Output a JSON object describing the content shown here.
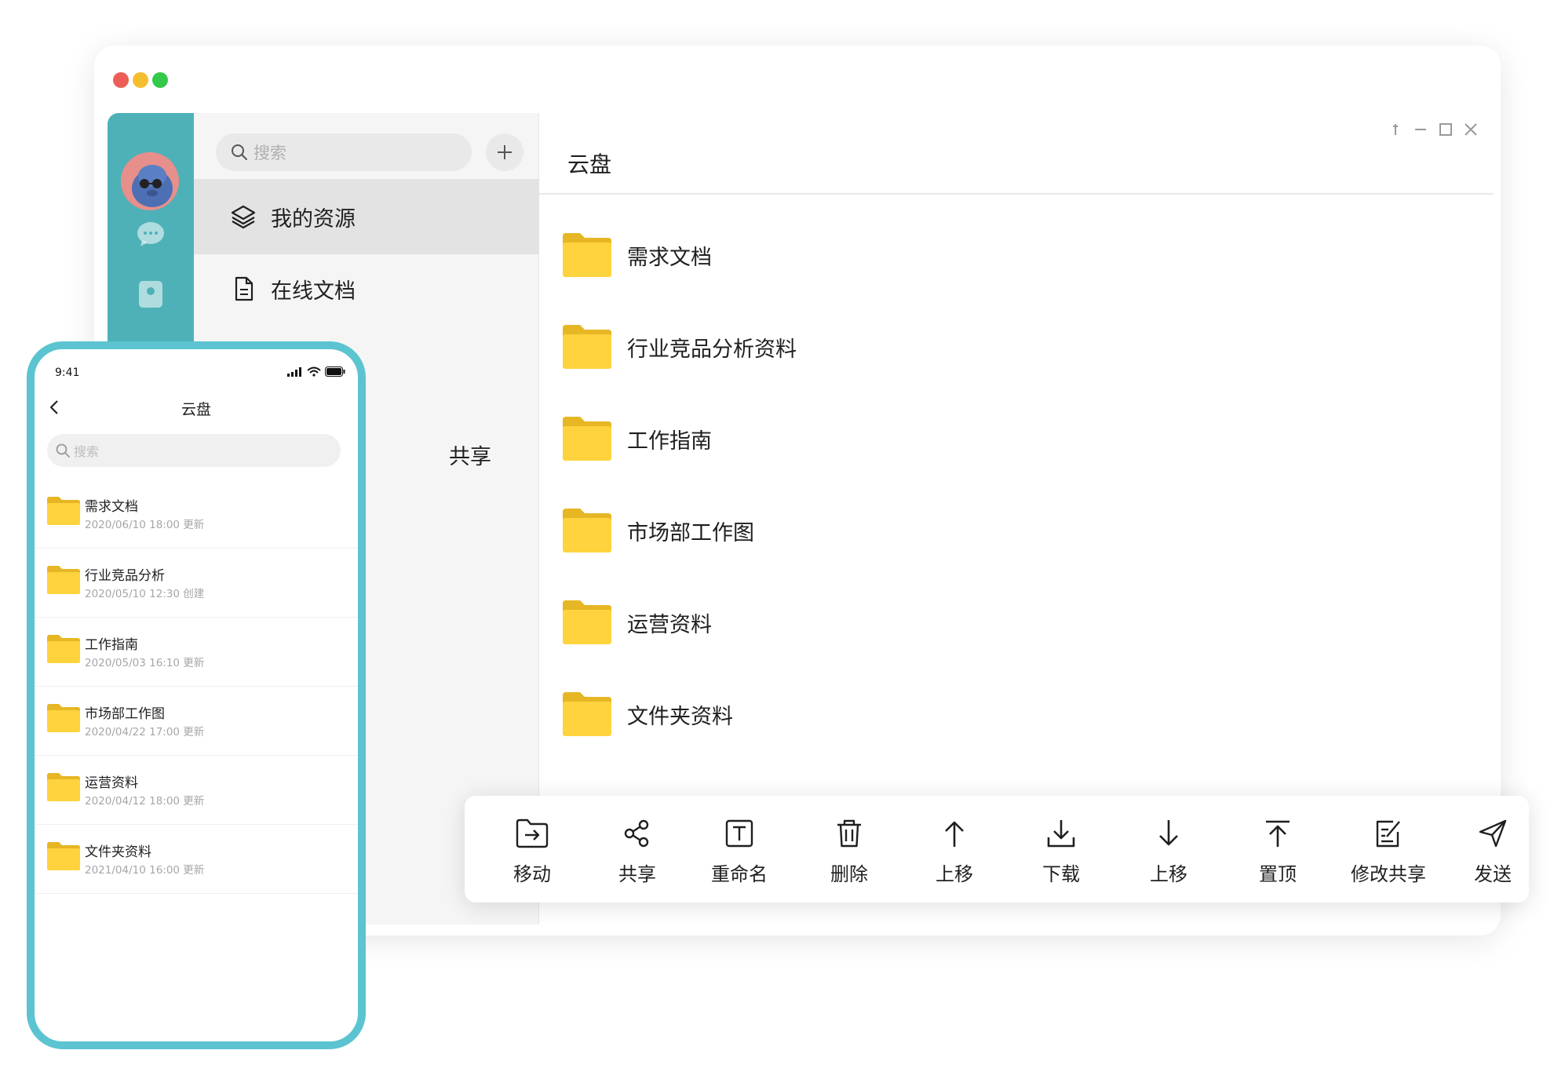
{
  "window": {
    "traffic_lights": {
      "close": "#ed5e58",
      "minimize": "#f5be2f",
      "maximize": "#34c94a"
    }
  },
  "colors": {
    "rail": "#4eb1b8",
    "folder_body": "#ffd33d",
    "folder_tab": "#e6b624",
    "phone_frame": "#5bc4d0"
  },
  "sidebar": {
    "search_placeholder": "搜索",
    "add_icon": "plus-icon",
    "items": [
      {
        "label": "我的资源",
        "icon": "layers-icon",
        "active": true
      },
      {
        "label": "在线文档",
        "icon": "document-icon",
        "active": false
      }
    ],
    "partial_item_text": "共享"
  },
  "main": {
    "title": "云盘",
    "folders": [
      {
        "name": "需求文档"
      },
      {
        "name": "行业竞品分析资料"
      },
      {
        "name": "工作指南"
      },
      {
        "name": "市场部工作图"
      },
      {
        "name": "运营资料"
      },
      {
        "name": "文件夹资料"
      }
    ]
  },
  "toolbar": {
    "actions": [
      {
        "label": "移动",
        "icon": "move-icon"
      },
      {
        "label": "共享",
        "icon": "share-icon"
      },
      {
        "label": "重命名",
        "icon": "rename-icon"
      },
      {
        "label": "删除",
        "icon": "trash-icon"
      },
      {
        "label": "上移",
        "icon": "arrow-up-icon"
      },
      {
        "label": "下载",
        "icon": "download-icon"
      },
      {
        "label": "上移",
        "icon": "arrow-down-icon"
      },
      {
        "label": "置顶",
        "icon": "pin-top-icon"
      },
      {
        "label": "修改共享",
        "icon": "edit-share-icon"
      },
      {
        "label": "发送",
        "icon": "send-icon"
      }
    ]
  },
  "phone": {
    "time": "9:41",
    "title": "云盘",
    "search_placeholder": "搜索",
    "folders": [
      {
        "name": "需求文档",
        "date": "2020/06/10 18:00 更新"
      },
      {
        "name": "行业竞品分析",
        "date": "2020/05/10 12:30 创建"
      },
      {
        "name": "工作指南",
        "date": "2020/05/03 16:10 更新"
      },
      {
        "name": "市场部工作图",
        "date": "2020/04/22 17:00 更新"
      },
      {
        "name": "运营资料",
        "date": "2020/04/12 18:00 更新"
      },
      {
        "name": "文件夹资料",
        "date": "2021/04/10 16:00 更新"
      }
    ]
  }
}
